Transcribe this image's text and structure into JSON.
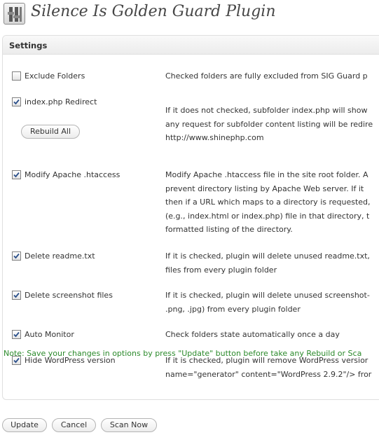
{
  "page": {
    "title": "Silence Is Golden Guard Plugin",
    "icon": "plugin-settings-icon"
  },
  "settings": {
    "title": "Settings",
    "rows": [
      {
        "id": "exclude_folders",
        "label": "Exclude Folders",
        "checked": false,
        "description": [
          "Checked folders are fully excluded from SIG Guard p"
        ]
      },
      {
        "id": "index_redirect",
        "label": "index.php Redirect",
        "checked": true,
        "description": [
          "If it does not checked, subfolder index.php will show",
          "any request for subfolder content listing will be redire",
          "http://www.shinephp.com"
        ]
      },
      {
        "id": "modify_htaccess",
        "label": "Modify Apache .htaccess",
        "checked": true,
        "description": [
          "Modify Apache .htaccess file in the site root folder. A",
          "prevent directory listing by Apache Web server. If it",
          "then if a URL which maps to a directory is requested,",
          "(e.g., index.html or index.php) file in that directory, t",
          "formatted listing of the directory."
        ]
      },
      {
        "id": "delete_readme",
        "label": "Delete readme.txt",
        "checked": true,
        "description": [
          "If it is checked, plugin will delete unused readme.txt,",
          "files from every plugin folder"
        ]
      },
      {
        "id": "delete_screenshots",
        "label": "Delete screenshot files",
        "checked": true,
        "description": [
          "If it is checked, plugin will delete unused screenshot-",
          ".png, .jpg) from every plugin folder"
        ]
      },
      {
        "id": "auto_monitor",
        "label": "Auto Monitor",
        "checked": true,
        "description": [
          "Check folders state automatically once a day"
        ]
      },
      {
        "id": "hide_wp_version",
        "label": "Hide WordPress version",
        "checked": true,
        "description": [
          "If it is checked, plugin will remove WordPress versior",
          "name=\"generator\" content=\"WordPress 2.9.2\"/> fror"
        ]
      }
    ],
    "rebuild_label": "Rebuild All",
    "note": "Note: Save your changes in options by press \"Update\" button before take any Rebuild or Sca"
  },
  "buttons": {
    "update": "Update",
    "cancel": "Cancel",
    "scan": "Scan Now"
  },
  "colors": {
    "note": "#2b8a2b",
    "title": "#464646",
    "border": "#dfdfdf"
  }
}
